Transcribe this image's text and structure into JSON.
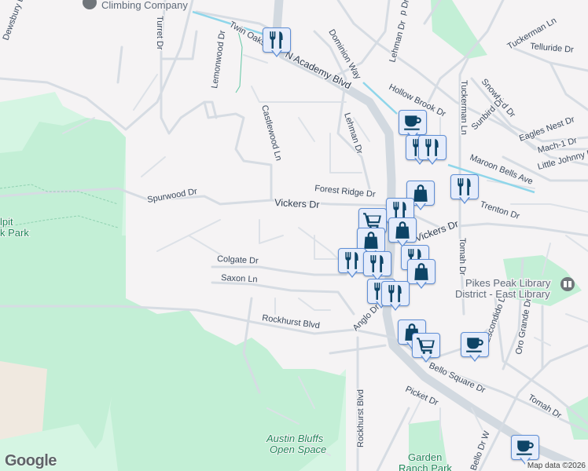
{
  "map": {
    "colors": {
      "background": "#f5f3f4",
      "park": "#c3efd6",
      "road": "#d6dce3",
      "marker_bg": "#e5ecfb",
      "marker_icon": "#0d4466",
      "trail": "#8fd6ea"
    },
    "streets": {
      "dewsbury": "Dewsbury Dr",
      "turret": "Turret Dr",
      "lemonwood": "Lemonwood Dr",
      "twin_oaks": "Twin Oaks Dr",
      "n_academy": "N Academy Blvd",
      "dominion": "Dominion Way",
      "lehman_top": "Lehman Dr",
      "lehman_mid": "Lehman Dr",
      "castlewood": "Castlewood Ln",
      "spurwood": "Spurwood Dr",
      "vickers_w": "Vickers Dr",
      "vickers_e": "Vickers Dr",
      "forest_ridge": "Forest Ridge Dr",
      "hollow_brook": "Hollow Brook Dr",
      "tuckerman_top": "Tuckerman Ln",
      "tuckerman_mid": "Tuckerman Ln",
      "telluride": "Telluride Dr",
      "snowbird": "Snowbird Dr",
      "sunbird": "Sunbird Dr",
      "eagles_nest": "Eagles Nest Dr",
      "mach1": "Mach-1 Dr",
      "little_johnny": "Little Johnny Dr",
      "maroon_bells": "Maroon Bells Ave",
      "trenton": "Trenton Dr",
      "colgate": "Colgate Dr",
      "saxon": "Saxon Ln",
      "rockhurst": "Rockhurst Blvd",
      "rockhurst_v": "Rockhurst Blvd",
      "anglo": "Anglo Dr",
      "tomah_v": "Tomah Dr",
      "tomah": "Tomah Dr",
      "escondido": "Escondido Dr",
      "oro_grande": "Oro Grande Dr",
      "bello_square": "Bello Square Dr",
      "picket": "Picket Dr",
      "bello_w": "Bello Dr W",
      "hollow_top": "p Dr"
    },
    "places": {
      "climbing": "Climbing Company",
      "library_1": "Pikes Peak Library",
      "library_2": "District - East Library",
      "austin_1": "Austin Bluffs",
      "austin_2": "Open Space",
      "garden_1": "Garden",
      "garden_2": "Ranch Park",
      "pulpit_1": "lpit",
      "pulpit_2": "k Park"
    },
    "markers": [
      {
        "type": "restaurant-icon"
      },
      {
        "type": "coffee-icon"
      },
      {
        "type": "restaurant-icon"
      },
      {
        "type": "restaurant-icon"
      },
      {
        "type": "shopping-bag-icon"
      },
      {
        "type": "restaurant-icon"
      },
      {
        "type": "restaurant-icon"
      },
      {
        "type": "shopping-cart-icon"
      },
      {
        "type": "shopping-bag-icon"
      },
      {
        "type": "shopping-bag-icon"
      },
      {
        "type": "restaurant-icon"
      },
      {
        "type": "restaurant-icon"
      },
      {
        "type": "restaurant-icon"
      },
      {
        "type": "shopping-bag-icon"
      },
      {
        "type": "restaurant-icon"
      },
      {
        "type": "restaurant-icon"
      },
      {
        "type": "shopping-bag-icon"
      },
      {
        "type": "shopping-cart-icon"
      },
      {
        "type": "coffee-icon"
      },
      {
        "type": "coffee-icon"
      }
    ],
    "logo": "Google",
    "attribution": "Map data ©2026"
  }
}
